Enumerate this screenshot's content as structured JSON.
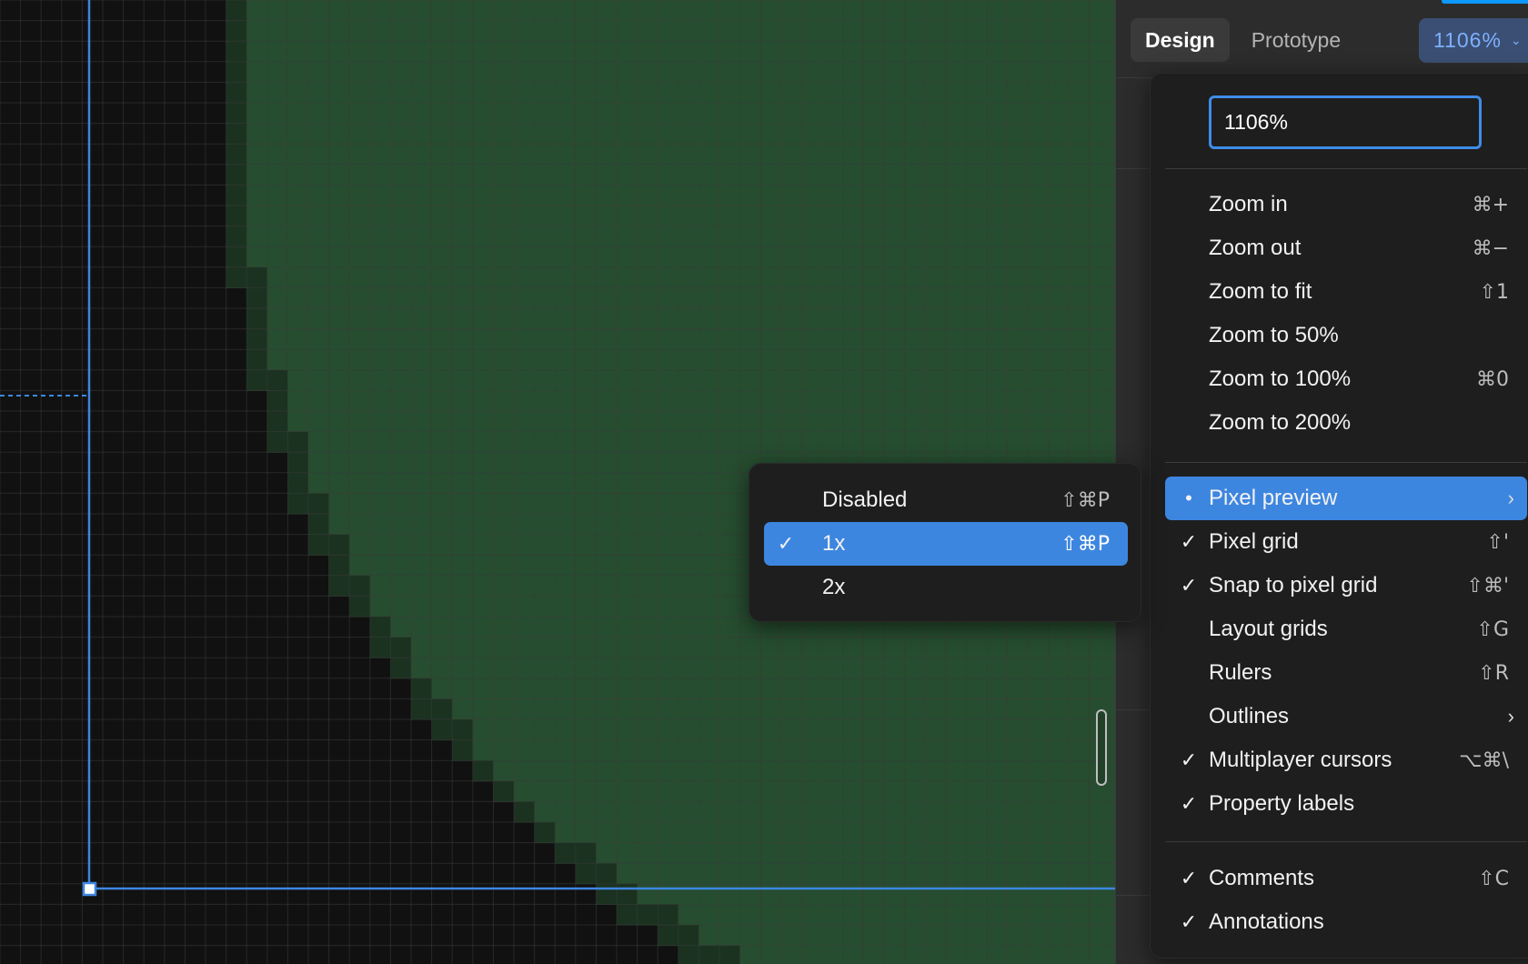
{
  "panel": {
    "tabs": [
      {
        "label": "Design",
        "active": true
      },
      {
        "label": "Prototype",
        "active": false
      }
    ],
    "zoom_label": "1106%"
  },
  "zoom_menu": {
    "input_value": "1106%",
    "zoom_items": [
      {
        "label": "Zoom in",
        "shortcut": "⌘+"
      },
      {
        "label": "Zoom out",
        "shortcut": "⌘−"
      },
      {
        "label": "Zoom to fit",
        "shortcut": "⇧1"
      },
      {
        "label": "Zoom to 50%",
        "shortcut": ""
      },
      {
        "label": "Zoom to 100%",
        "shortcut": "⌘0"
      },
      {
        "label": "Zoom to 200%",
        "shortcut": ""
      }
    ],
    "view_items": [
      {
        "label": "Pixel preview",
        "shortcut": "",
        "checked": false,
        "bullet": true,
        "submenu": true,
        "highlight": true
      },
      {
        "label": "Pixel grid",
        "shortcut": "⇧'",
        "checked": true
      },
      {
        "label": "Snap to pixel grid",
        "shortcut": "⇧⌘'",
        "checked": true
      },
      {
        "label": "Layout grids",
        "shortcut": "⇧G",
        "checked": false
      },
      {
        "label": "Rulers",
        "shortcut": "⇧R",
        "checked": false
      },
      {
        "label": "Outlines",
        "shortcut": "",
        "checked": false,
        "submenu": true
      },
      {
        "label": "Multiplayer cursors",
        "shortcut": "⌥⌘\\",
        "checked": true
      },
      {
        "label": "Property labels",
        "shortcut": "",
        "checked": true
      }
    ],
    "comment_items": [
      {
        "label": "Comments",
        "shortcut": "⇧C",
        "checked": true
      },
      {
        "label": "Annotations",
        "shortcut": "",
        "checked": true
      }
    ]
  },
  "pixel_submenu": {
    "items": [
      {
        "label": "Disabled",
        "shortcut": "⇧⌘P",
        "checked": false
      },
      {
        "label": "1x",
        "shortcut": "⇧⌘P",
        "checked": true,
        "highlight": true
      },
      {
        "label": "2x",
        "shortcut": "",
        "checked": false
      }
    ]
  },
  "symbols": {
    "check": "✓",
    "bullet": "•",
    "arrow": "›",
    "chevron": "⌄"
  },
  "colors": {
    "canvas_bg": "#111111",
    "shape_fill": "#264d2f",
    "shape_edge": "#1b3220",
    "grid_line": "#3b3b3b",
    "selection": "#3d86e0",
    "menu_bg": "#1e1e1e",
    "highlight": "#3d86e0"
  }
}
